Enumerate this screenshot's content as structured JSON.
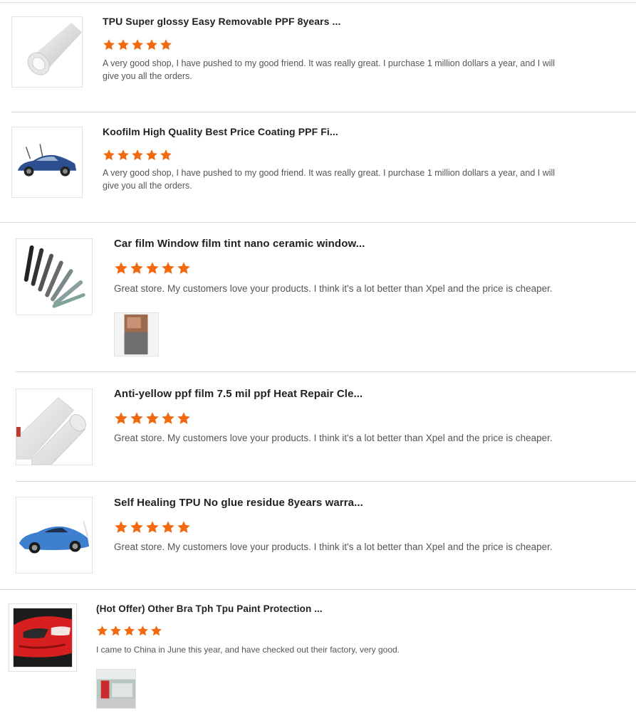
{
  "colors": {
    "star": "#f26a10",
    "divider": "#d8d8d8"
  },
  "reviews": [
    {
      "title": "TPU Super glossy Easy Removable PPF 8years ...",
      "rating": 5,
      "comment": "A very good shop, I have pushed to my good friend. It was really great. I purchase 1 million dollars a year, and I will give you all the orders.",
      "thumbnail": "white-film-roll-image",
      "has_photo": false
    },
    {
      "title": "Koofilm High Quality Best Price Coating PPF Fi...",
      "rating": 5,
      "comment": "A very good shop, I have pushed to my good friend. It was really great. I purchase 1 million dollars a year, and I will give you all the orders.",
      "thumbnail": "blue-car-image",
      "has_photo": false
    },
    {
      "title": "Car film Window film tint nano ceramic window...",
      "rating": 5,
      "comment": "Great store. My customers love your products. I think it's a lot better than Xpel and the price is cheaper.",
      "thumbnail": "tint-film-rolls-image",
      "has_photo": true,
      "photo": "customer-photo-box"
    },
    {
      "title": "Anti-yellow ppf film 7.5 mil ppf Heat Repair Cle...",
      "rating": 5,
      "comment": "Great store. My customers love your products. I think it's a lot better than Xpel and the price is cheaper.",
      "thumbnail": "clear-film-rolls-image",
      "has_photo": false
    },
    {
      "title": "Self Healing TPU No glue residue 8years warra...",
      "rating": 5,
      "comment": "Great store. My customers love your products. I think it's a lot better than Xpel and the price is cheaper.",
      "thumbnail": "blue-tesla-image",
      "has_photo": false
    },
    {
      "title": "(Hot Offer) Other Bra Tph Tpu Paint Protection ...",
      "rating": 5,
      "comment": "I came to China in June this year, and have checked out their factory, very good.",
      "thumbnail": "red-car-image",
      "has_photo": true,
      "photo": "customer-photo-workshop"
    }
  ]
}
